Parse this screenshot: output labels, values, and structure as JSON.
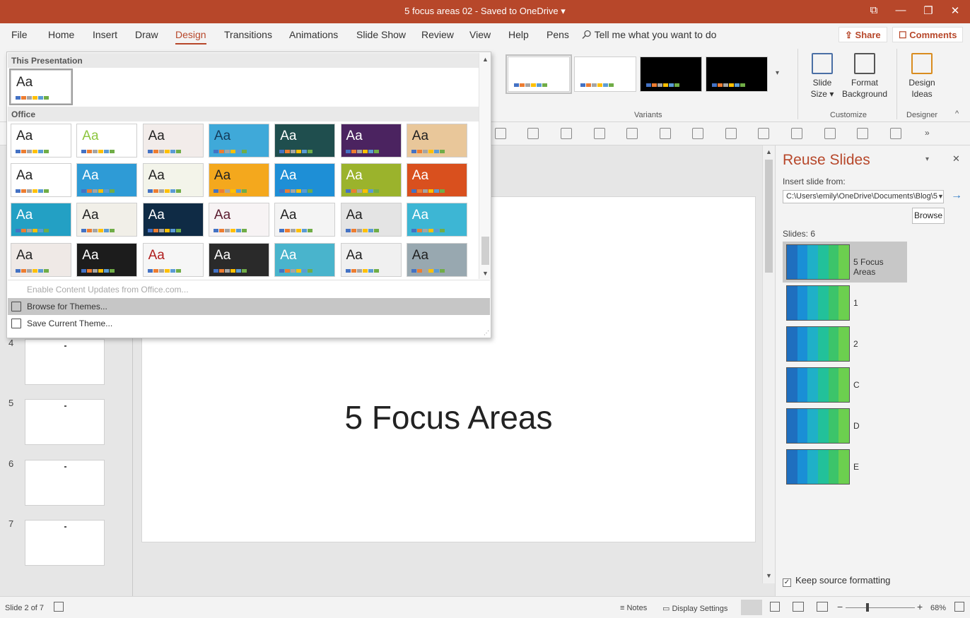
{
  "title_bar": {
    "doc_title": "5 focus areas 02  -  Saved to OneDrive",
    "caret": "▾",
    "restore_icon": "⧉",
    "minimize": "—",
    "maximize": "❐",
    "close": "✕",
    "color": "#b7472a"
  },
  "tabs": [
    "File",
    "Home",
    "Insert",
    "Draw",
    "Design",
    "Transitions",
    "Animations",
    "Slide Show",
    "Review",
    "View",
    "Help",
    "Pens"
  ],
  "active_tab": "Design",
  "tell_me": "Tell me what you want to do",
  "share": "Share",
  "comments": "Comments",
  "ribbon": {
    "variants_label": "Variants",
    "customize_label": "Customize",
    "designer_label": "Designer",
    "slide_size": "Slide Size ▾",
    "format_background": "Format Background",
    "design_ideas": "Design Ideas",
    "more_arrow": "▾",
    "collapse_arrow": "^"
  },
  "gallery": {
    "this_presentation": "This Presentation",
    "office": "Office",
    "aa": "Aa",
    "enable_updates": "Enable Content Updates from Office.com...",
    "browse_themes": "Browse for Themes...",
    "save_theme": "Save Current Theme...",
    "up": "▲",
    "down": "▼"
  },
  "thumbnails": [
    {
      "num": "4"
    },
    {
      "num": "5"
    },
    {
      "num": "6"
    },
    {
      "num": "7"
    }
  ],
  "slide": {
    "title": "5 Focus Areas"
  },
  "reuse": {
    "title": "Reuse Slides",
    "insert_from": "Insert slide from:",
    "path": "C:\\Users\\emily\\OneDrive\\Documents\\Blog\\5",
    "browse": "Browse",
    "slides_count": "Slides: 6",
    "close": "✕",
    "menu": "▾",
    "go": "→",
    "items": [
      {
        "label": "5 Focus Areas"
      },
      {
        "label": "1"
      },
      {
        "label": "2"
      },
      {
        "label": "C"
      },
      {
        "label": "D"
      },
      {
        "label": "E"
      }
    ],
    "keep_source": "Keep source formatting",
    "check": "✓"
  },
  "status": {
    "slide_of": "Slide 2 of 7",
    "notes": "Notes",
    "display_settings": "Display Settings",
    "zoom": "68%",
    "minus": "−",
    "plus": "+"
  },
  "colors": {
    "accent": "#b7472a",
    "palette": [
      "#4472c4",
      "#ed7d31",
      "#a5a5a5",
      "#ffc000",
      "#5b9bd5",
      "#70ad47"
    ],
    "reuse_stripes": [
      "#1f6fbf",
      "#1a8fd6",
      "#1fb0c8",
      "#22c19a",
      "#3cc46a",
      "#6ccf4f"
    ]
  }
}
